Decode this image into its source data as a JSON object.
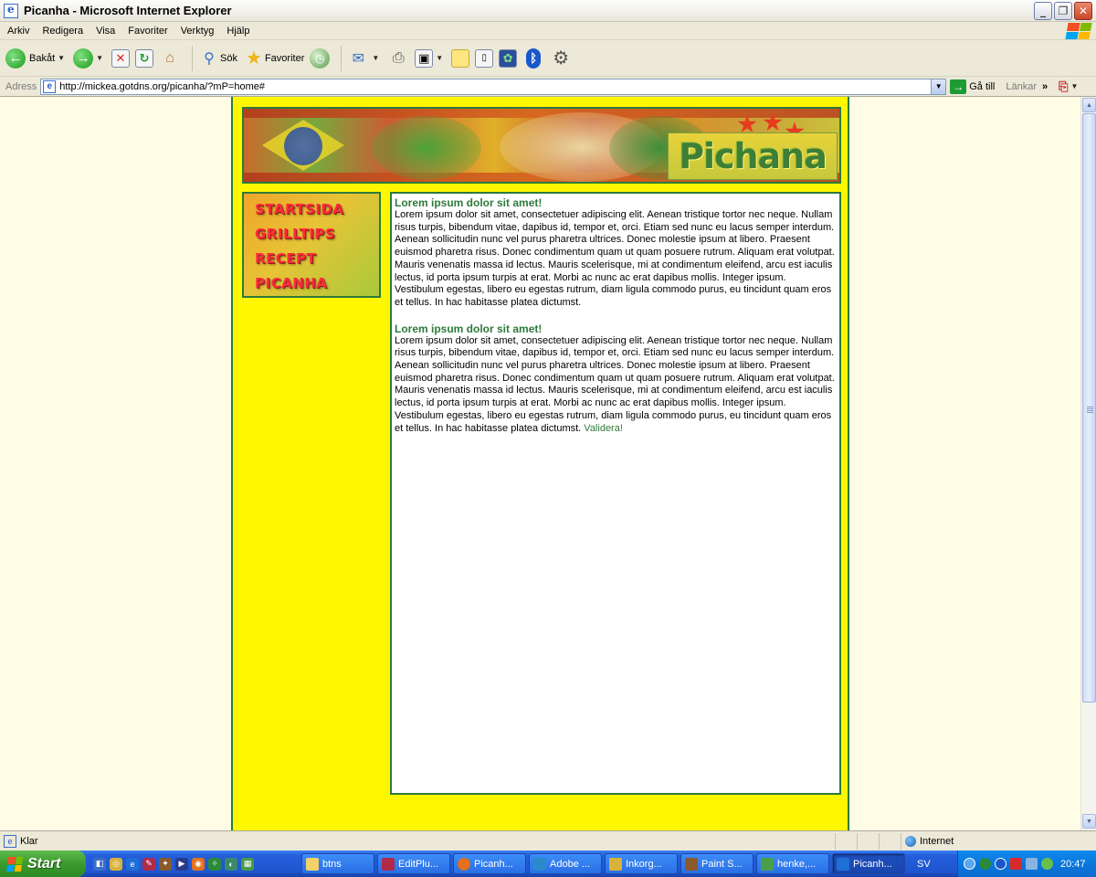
{
  "window": {
    "title": "Picanha - Microsoft Internet Explorer"
  },
  "menu": [
    "Arkiv",
    "Redigera",
    "Visa",
    "Favoriter",
    "Verktyg",
    "Hjälp"
  ],
  "toolbar": {
    "back_label": "Bakåt",
    "search_label": "Sök",
    "favorites_label": "Favoriter"
  },
  "addressbar": {
    "label": "Adress",
    "url": "http://mickea.gotdns.org/picanha/?mP=home#",
    "go_label": "Gå till",
    "links_label": "Länkar",
    "links_more": "»"
  },
  "site": {
    "logo": "Pichana",
    "nav": [
      "STARTSIDA",
      "GRILLTIPS",
      "RECEPT",
      "PICANHA"
    ],
    "articles": [
      {
        "heading": "Lorem ipsum dolor sit amet!",
        "body": "Lorem ipsum dolor sit amet, consectetuer adipiscing elit. Aenean tristique tortor nec neque. Nullam risus turpis, bibendum vitae, dapibus id, tempor et, orci. Etiam sed nunc eu lacus semper interdum. Aenean sollicitudin nunc vel purus pharetra ultrices. Donec molestie ipsum at libero. Praesent euismod pharetra risus. Donec condimentum quam ut quam posuere rutrum. Aliquam erat volutpat. Mauris venenatis massa id lectus. Mauris scelerisque, mi at condimentum eleifend, arcu est iaculis lectus, id porta ipsum turpis at erat. Morbi ac nunc ac erat dapibus mollis. Integer ipsum. Vestibulum egestas, libero eu egestas rutrum, diam ligula commodo purus, eu tincidunt quam eros et tellus. In hac habitasse platea dictumst."
      },
      {
        "heading": "Lorem ipsum dolor sit amet!",
        "body": "Lorem ipsum dolor sit amet, consectetuer adipiscing elit. Aenean tristique tortor nec neque. Nullam risus turpis, bibendum vitae, dapibus id, tempor et, orci. Etiam sed nunc eu lacus semper interdum. Aenean sollicitudin nunc vel purus pharetra ultrices. Donec molestie ipsum at libero. Praesent euismod pharetra risus. Donec condimentum quam ut quam posuere rutrum. Aliquam erat volutpat. Mauris venenatis massa id lectus. Mauris scelerisque, mi at condimentum eleifend, arcu est iaculis lectus, id porta ipsum turpis at erat. Morbi ac nunc ac erat dapibus mollis. Integer ipsum. Vestibulum egestas, libero eu egestas rutrum, diam ligula commodo purus, eu tincidunt quam eros et tellus. In hac habitasse platea dictumst."
      }
    ],
    "validate_link": "Validera!"
  },
  "statusbar": {
    "status": "Klar",
    "zone": "Internet"
  },
  "taskbar": {
    "start_label": "Start",
    "tasks": [
      "btns",
      "EditPlu...",
      "Picanh...",
      "Adobe ...",
      "Inkorg...",
      "Paint S...",
      "henke,...",
      "Picanh..."
    ],
    "language": "SV",
    "clock": "20:47"
  },
  "colors": {
    "page_yellow": "#fff700",
    "page_green": "#2e7a3a",
    "nav_red": "#ff2a3a",
    "viewport_bg": "#fffde6"
  },
  "icons": [
    "back-icon",
    "forward-icon",
    "stop-icon",
    "refresh-icon",
    "home-icon",
    "search-icon",
    "favorites-star-icon",
    "history-icon",
    "mail-icon",
    "print-icon",
    "edit-icon",
    "notes-icon",
    "messenger-icon",
    "bluetooth-icon",
    "settings-icon"
  ]
}
